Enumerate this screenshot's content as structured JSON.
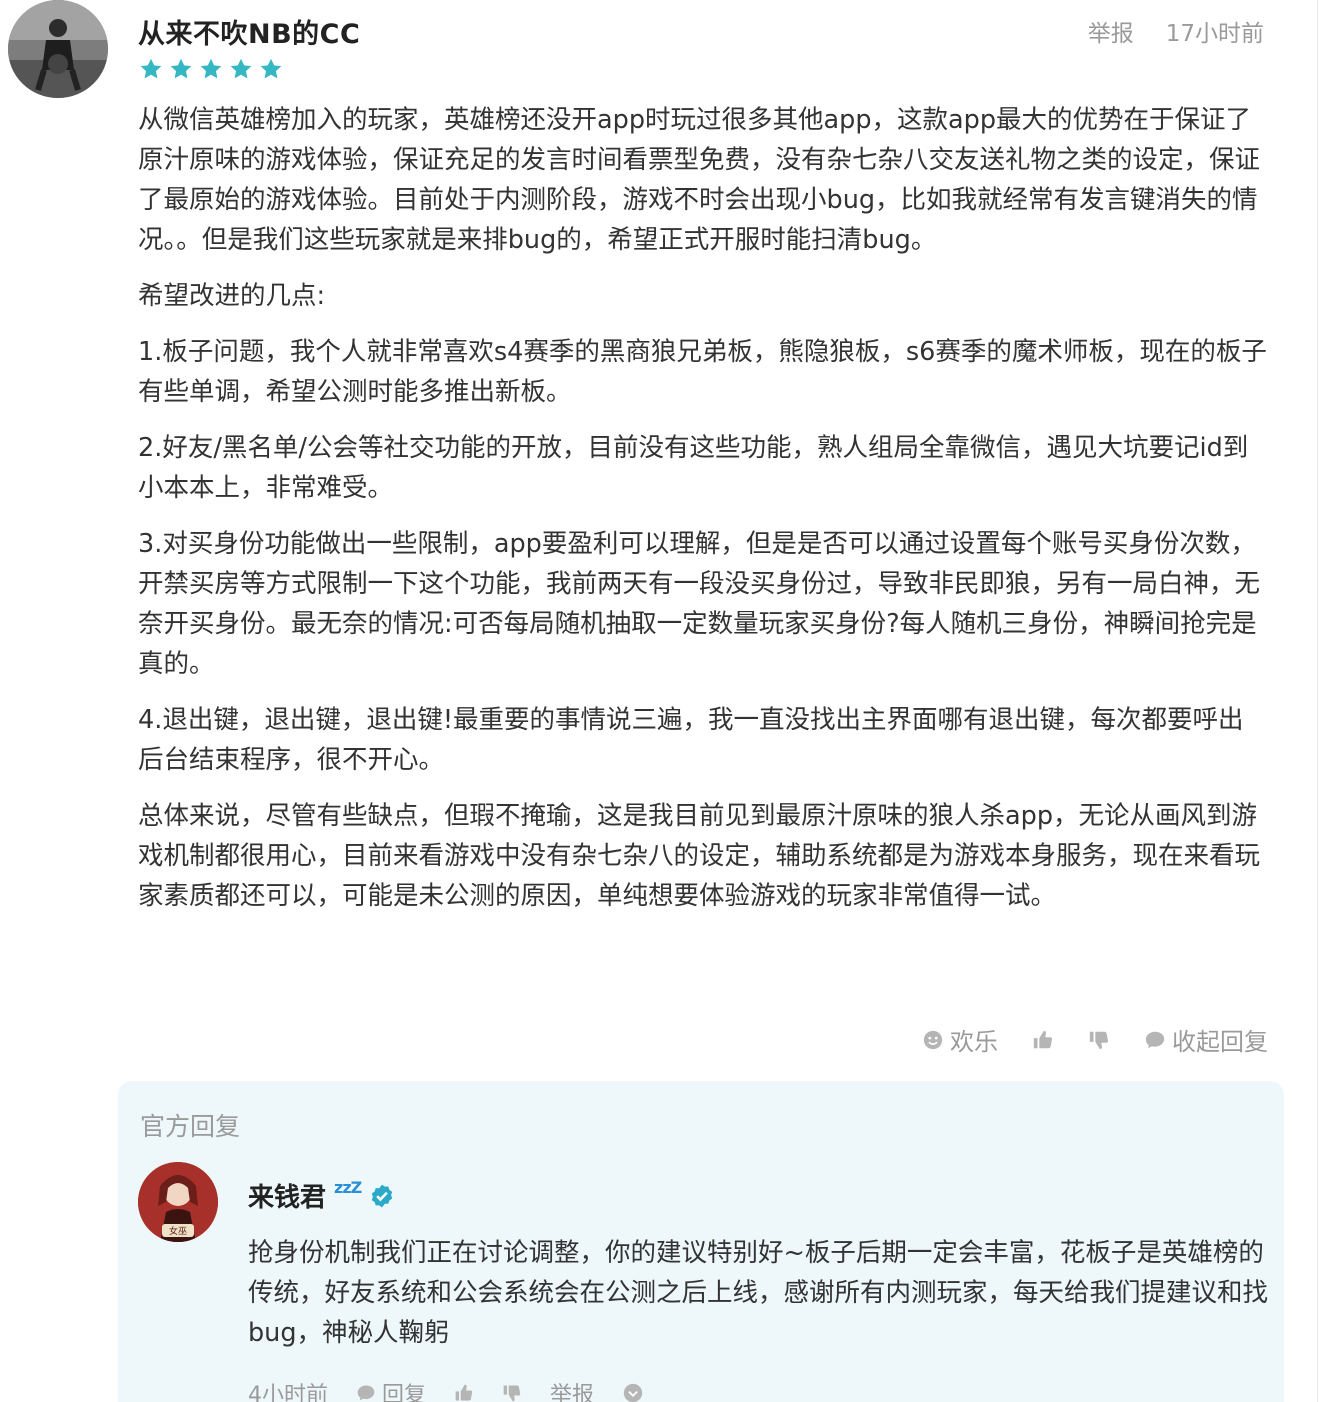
{
  "review": {
    "username": "从来不吹NB的CC",
    "rating": 5,
    "report_label": "举报",
    "time": "17小时前",
    "paragraphs": [
      "从微信英雄榜加入的玩家，英雄榜还没开app时玩过很多其他app，这款app最大的优势在于保证了原汁原味的游戏体验，保证充足的发言时间看票型免费，没有杂七杂八交友送礼物之类的设定，保证了最原始的游戏体验。目前处于内测阶段，游戏不时会出现小bug，比如我就经常有发言键消失的情况。。但是我们这些玩家就是来排bug的，希望正式开服时能扫清bug。",
      "希望改进的几点:",
      "1.板子问题，我个人就非常喜欢s4赛季的黑商狼兄弟板，熊隐狼板，s6赛季的魔术师板，现在的板子有些单调，希望公测时能多推出新板。",
      "2.好友/黑名单/公会等社交功能的开放，目前没有这些功能，熟人组局全靠微信，遇见大坑要记id到小本本上，非常难受。",
      "3.对买身份功能做出一些限制，app要盈利可以理解，但是是否可以通过设置每个账号买身份次数，开禁买房等方式限制一下这个功能，我前两天有一段没买身份过，导致非民即狼，另有一局白神，无奈开买身份。最无奈的情况:可否每局随机抽取一定数量玩家买身份?每人随机三身份，神瞬间抢完是真的。",
      "4.退出键，退出键，退出键!最重要的事情说三遍，我一直没找出主界面哪有退出键，每次都要呼出后台结束程序，很不开心。",
      "总体来说，尽管有些缺点，但瑕不掩瑜，这是我目前见到最原汁原味的狼人杀app，无论从画风到游戏机制都很用心，目前来看游戏中没有杂七杂八的设定，辅助系统都是为游戏本身服务，现在来看玩家素质都还可以，可能是未公测的原因，单纯想要体验游戏的玩家非常值得一试。"
    ],
    "actions": {
      "fun_label": "欢乐",
      "collapse_label": "收起回复"
    }
  },
  "official_reply": {
    "section_title": "官方回复",
    "name": "来钱君",
    "name_suffix": "zzZ",
    "avatar_badge": "女巫",
    "text": "抢身份机制我们正在讨论调整，你的建议特别好~板子后期一定会丰富，花板子是英雄榜的传统，好友系统和公会系统会在公测之后上线，感谢所有内测玩家，每天给我们提建议和找bug，神秘人鞠躬",
    "time": "4小时前",
    "reply_label": "回复",
    "report_label": "举报"
  },
  "colors": {
    "star": "#35b8c4",
    "muted": "#9a9a9a",
    "official_bg": "#eef8fb",
    "verified": "#2aa9c9"
  },
  "icons": [
    "star-icon",
    "smiley-icon",
    "thumbs-up-icon",
    "thumbs-down-icon",
    "comment-icon",
    "verified-icon",
    "more-icon"
  ]
}
